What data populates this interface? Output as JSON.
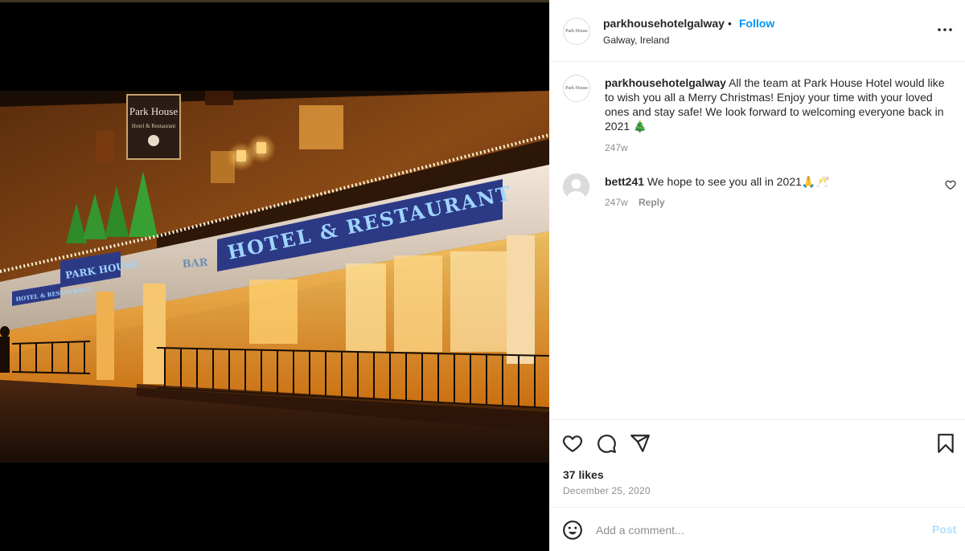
{
  "post": {
    "account": {
      "username": "parkhousehotelgalway",
      "separator": "•",
      "follow_label": "Follow",
      "location": "Galway, Ireland",
      "avatar_icon": "park-house-logo",
      "logo_text": "Park House"
    },
    "more_icon": "more-horizontal-icon",
    "caption": {
      "username": "parkhousehotelgalway",
      "text": "All the team at Park House Hotel would like to wish you all a Merry Christmas! Enjoy your time with your loved ones and stay safe! We look forward to welcoming everyone back in 2021 🎄",
      "time": "247w"
    },
    "comments": [
      {
        "username": "bett241",
        "text": "We hope to see you all in 2021🙏🥂",
        "time": "247w",
        "reply_label": "Reply"
      }
    ],
    "actions": {
      "like_icon": "heart-icon",
      "comment_icon": "comment-icon",
      "share_icon": "share-icon",
      "save_icon": "bookmark-icon"
    },
    "likes": "37 likes",
    "date": "December 25, 2020",
    "add_comment": {
      "placeholder": "Add a comment...",
      "post_label": "Post",
      "emoji_icon": "emoji-icon"
    }
  },
  "photo": {
    "sign_hotel_restaurant": "HOTEL & RESTAURANT",
    "sign_park_house": "PARK HOUSE",
    "sign_bar": "BAR",
    "sign_hotel_restaurant_small": "HOTEL & RESTAURANT",
    "hanging_sign": "Park House",
    "hanging_sign_sub": "Hotel & Restaurant"
  },
  "colors": {
    "accent": "#0095f6",
    "post_disabled": "#b2dffc",
    "muted": "#8e8e8e",
    "text": "#262626"
  }
}
